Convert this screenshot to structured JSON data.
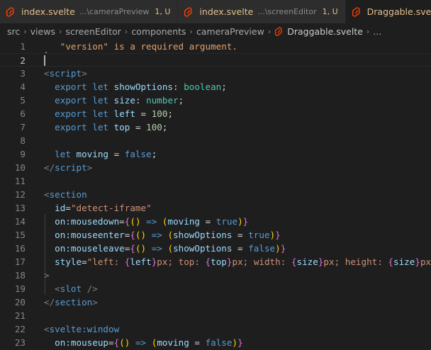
{
  "tabs": [
    {
      "name": "index.svelte",
      "desc": "...\\cameraPreview",
      "status": "1, U",
      "active": false
    },
    {
      "name": "index.svelte",
      "desc": "...\\screenEditor",
      "status": "1, U",
      "active": false
    },
    {
      "name": "Draggable.svelte",
      "desc": "",
      "status": "",
      "active": true
    }
  ],
  "breadcrumb": {
    "parts": [
      "src",
      "views",
      "screenEditor",
      "components",
      "cameraPreview"
    ],
    "file": "Draggable.svelte",
    "ellipsis": "..."
  },
  "colors": {
    "svelte_icon": "#ff3e00",
    "modified_text": "#e2c08d",
    "background": "#1e1e1e"
  },
  "editor": {
    "lines": [
      {
        "n": "1",
        "tokens": [
          [
            "err",
            "   \"version\" is a required argument."
          ]
        ]
      },
      {
        "n": "2",
        "tokens": [],
        "current": true
      },
      {
        "n": "3",
        "tokens": [
          [
            "br",
            "<"
          ],
          [
            "tag",
            "script"
          ],
          [
            "br",
            ">"
          ]
        ]
      },
      {
        "n": "4",
        "tokens": [
          [
            "op",
            "  "
          ],
          [
            "kw",
            "export"
          ],
          [
            "op",
            " "
          ],
          [
            "kw",
            "let"
          ],
          [
            "op",
            " "
          ],
          [
            "var",
            "showOptions"
          ],
          [
            "op",
            ": "
          ],
          [
            "type",
            "boolean"
          ],
          [
            "op",
            ";"
          ]
        ]
      },
      {
        "n": "5",
        "tokens": [
          [
            "op",
            "  "
          ],
          [
            "kw",
            "export"
          ],
          [
            "op",
            " "
          ],
          [
            "kw",
            "let"
          ],
          [
            "op",
            " "
          ],
          [
            "var",
            "size"
          ],
          [
            "op",
            ": "
          ],
          [
            "type",
            "number"
          ],
          [
            "op",
            ";"
          ]
        ]
      },
      {
        "n": "6",
        "tokens": [
          [
            "op",
            "  "
          ],
          [
            "kw",
            "export"
          ],
          [
            "op",
            " "
          ],
          [
            "kw",
            "let"
          ],
          [
            "op",
            " "
          ],
          [
            "var",
            "left"
          ],
          [
            "op",
            " = "
          ],
          [
            "num",
            "100"
          ],
          [
            "op",
            ";"
          ]
        ]
      },
      {
        "n": "7",
        "tokens": [
          [
            "op",
            "  "
          ],
          [
            "kw",
            "export"
          ],
          [
            "op",
            " "
          ],
          [
            "kw",
            "let"
          ],
          [
            "op",
            " "
          ],
          [
            "var",
            "top"
          ],
          [
            "op",
            " = "
          ],
          [
            "num",
            "100"
          ],
          [
            "op",
            ";"
          ]
        ]
      },
      {
        "n": "8",
        "tokens": []
      },
      {
        "n": "9",
        "tokens": [
          [
            "op",
            "  "
          ],
          [
            "kw",
            "let"
          ],
          [
            "op",
            " "
          ],
          [
            "var",
            "moving"
          ],
          [
            "op",
            " = "
          ],
          [
            "kw",
            "false"
          ],
          [
            "op",
            ";"
          ]
        ]
      },
      {
        "n": "10",
        "tokens": [
          [
            "br",
            "</"
          ],
          [
            "tag",
            "script"
          ],
          [
            "br",
            ">"
          ]
        ]
      },
      {
        "n": "11",
        "tokens": []
      },
      {
        "n": "12",
        "tokens": [
          [
            "br",
            "<"
          ],
          [
            "tag",
            "section"
          ]
        ]
      },
      {
        "n": "13",
        "tokens": [
          [
            "op",
            "  "
          ],
          [
            "attr",
            "id"
          ],
          [
            "op",
            "="
          ],
          [
            "str",
            "\"detect-iframe\""
          ]
        ]
      },
      {
        "n": "14",
        "tokens": [
          [
            "op",
            "  "
          ],
          [
            "attr",
            "on:mousedown"
          ],
          [
            "op",
            "="
          ],
          [
            "curly",
            "{"
          ],
          [
            "paren",
            "()"
          ],
          [
            "op",
            " "
          ],
          [
            "kw",
            "=>"
          ],
          [
            "op",
            " "
          ],
          [
            "paren",
            "("
          ],
          [
            "var",
            "moving"
          ],
          [
            "op",
            " = "
          ],
          [
            "kw",
            "true"
          ],
          [
            "paren",
            ")"
          ],
          [
            "curly",
            "}"
          ]
        ]
      },
      {
        "n": "15",
        "tokens": [
          [
            "op",
            "  "
          ],
          [
            "attr",
            "on:mouseenter"
          ],
          [
            "op",
            "="
          ],
          [
            "curly",
            "{"
          ],
          [
            "paren",
            "()"
          ],
          [
            "op",
            " "
          ],
          [
            "kw",
            "=>"
          ],
          [
            "op",
            " "
          ],
          [
            "paren",
            "("
          ],
          [
            "var",
            "showOptions"
          ],
          [
            "op",
            " = "
          ],
          [
            "kw",
            "true"
          ],
          [
            "paren",
            ")"
          ],
          [
            "curly",
            "}"
          ]
        ]
      },
      {
        "n": "16",
        "tokens": [
          [
            "op",
            "  "
          ],
          [
            "attr",
            "on:mouseleave"
          ],
          [
            "op",
            "="
          ],
          [
            "curly",
            "{"
          ],
          [
            "paren",
            "()"
          ],
          [
            "op",
            " "
          ],
          [
            "kw",
            "=>"
          ],
          [
            "op",
            " "
          ],
          [
            "paren",
            "("
          ],
          [
            "var",
            "showOptions"
          ],
          [
            "op",
            " = "
          ],
          [
            "kw",
            "false"
          ],
          [
            "paren",
            ")"
          ],
          [
            "curly",
            "}"
          ]
        ]
      },
      {
        "n": "17",
        "tokens": [
          [
            "op",
            "  "
          ],
          [
            "attr",
            "style"
          ],
          [
            "op",
            "="
          ],
          [
            "str",
            "\"left: "
          ],
          [
            "curly",
            "{"
          ],
          [
            "var",
            "left"
          ],
          [
            "curly",
            "}"
          ],
          [
            "str",
            "px; top: "
          ],
          [
            "curly",
            "{"
          ],
          [
            "var",
            "top"
          ],
          [
            "curly",
            "}"
          ],
          [
            "str",
            "px; width: "
          ],
          [
            "curly",
            "{"
          ],
          [
            "var",
            "size"
          ],
          [
            "curly",
            "}"
          ],
          [
            "str",
            "px; height: "
          ],
          [
            "curly",
            "{"
          ],
          [
            "var",
            "size"
          ],
          [
            "curly",
            "}"
          ],
          [
            "str",
            "px"
          ]
        ]
      },
      {
        "n": "18",
        "tokens": [
          [
            "br",
            ">"
          ]
        ]
      },
      {
        "n": "19",
        "tokens": [
          [
            "op",
            "  "
          ],
          [
            "br",
            "<"
          ],
          [
            "tag",
            "slot"
          ],
          [
            "op",
            " "
          ],
          [
            "br",
            "/>"
          ]
        ]
      },
      {
        "n": "20",
        "tokens": [
          [
            "br",
            "</"
          ],
          [
            "tag",
            "section"
          ],
          [
            "br",
            ">"
          ]
        ]
      },
      {
        "n": "21",
        "tokens": []
      },
      {
        "n": "22",
        "tokens": [
          [
            "br",
            "<"
          ],
          [
            "tag",
            "svelte:window"
          ]
        ]
      },
      {
        "n": "23",
        "tokens": [
          [
            "op",
            "  "
          ],
          [
            "attr",
            "on:mouseup"
          ],
          [
            "op",
            "="
          ],
          [
            "curly",
            "{"
          ],
          [
            "paren",
            "()"
          ],
          [
            "op",
            " "
          ],
          [
            "kw",
            "=>"
          ],
          [
            "op",
            " "
          ],
          [
            "paren",
            "("
          ],
          [
            "var",
            "moving"
          ],
          [
            "op",
            " = "
          ],
          [
            "kw",
            "false"
          ],
          [
            "paren",
            ")"
          ],
          [
            "curly",
            "}"
          ]
        ]
      }
    ]
  }
}
